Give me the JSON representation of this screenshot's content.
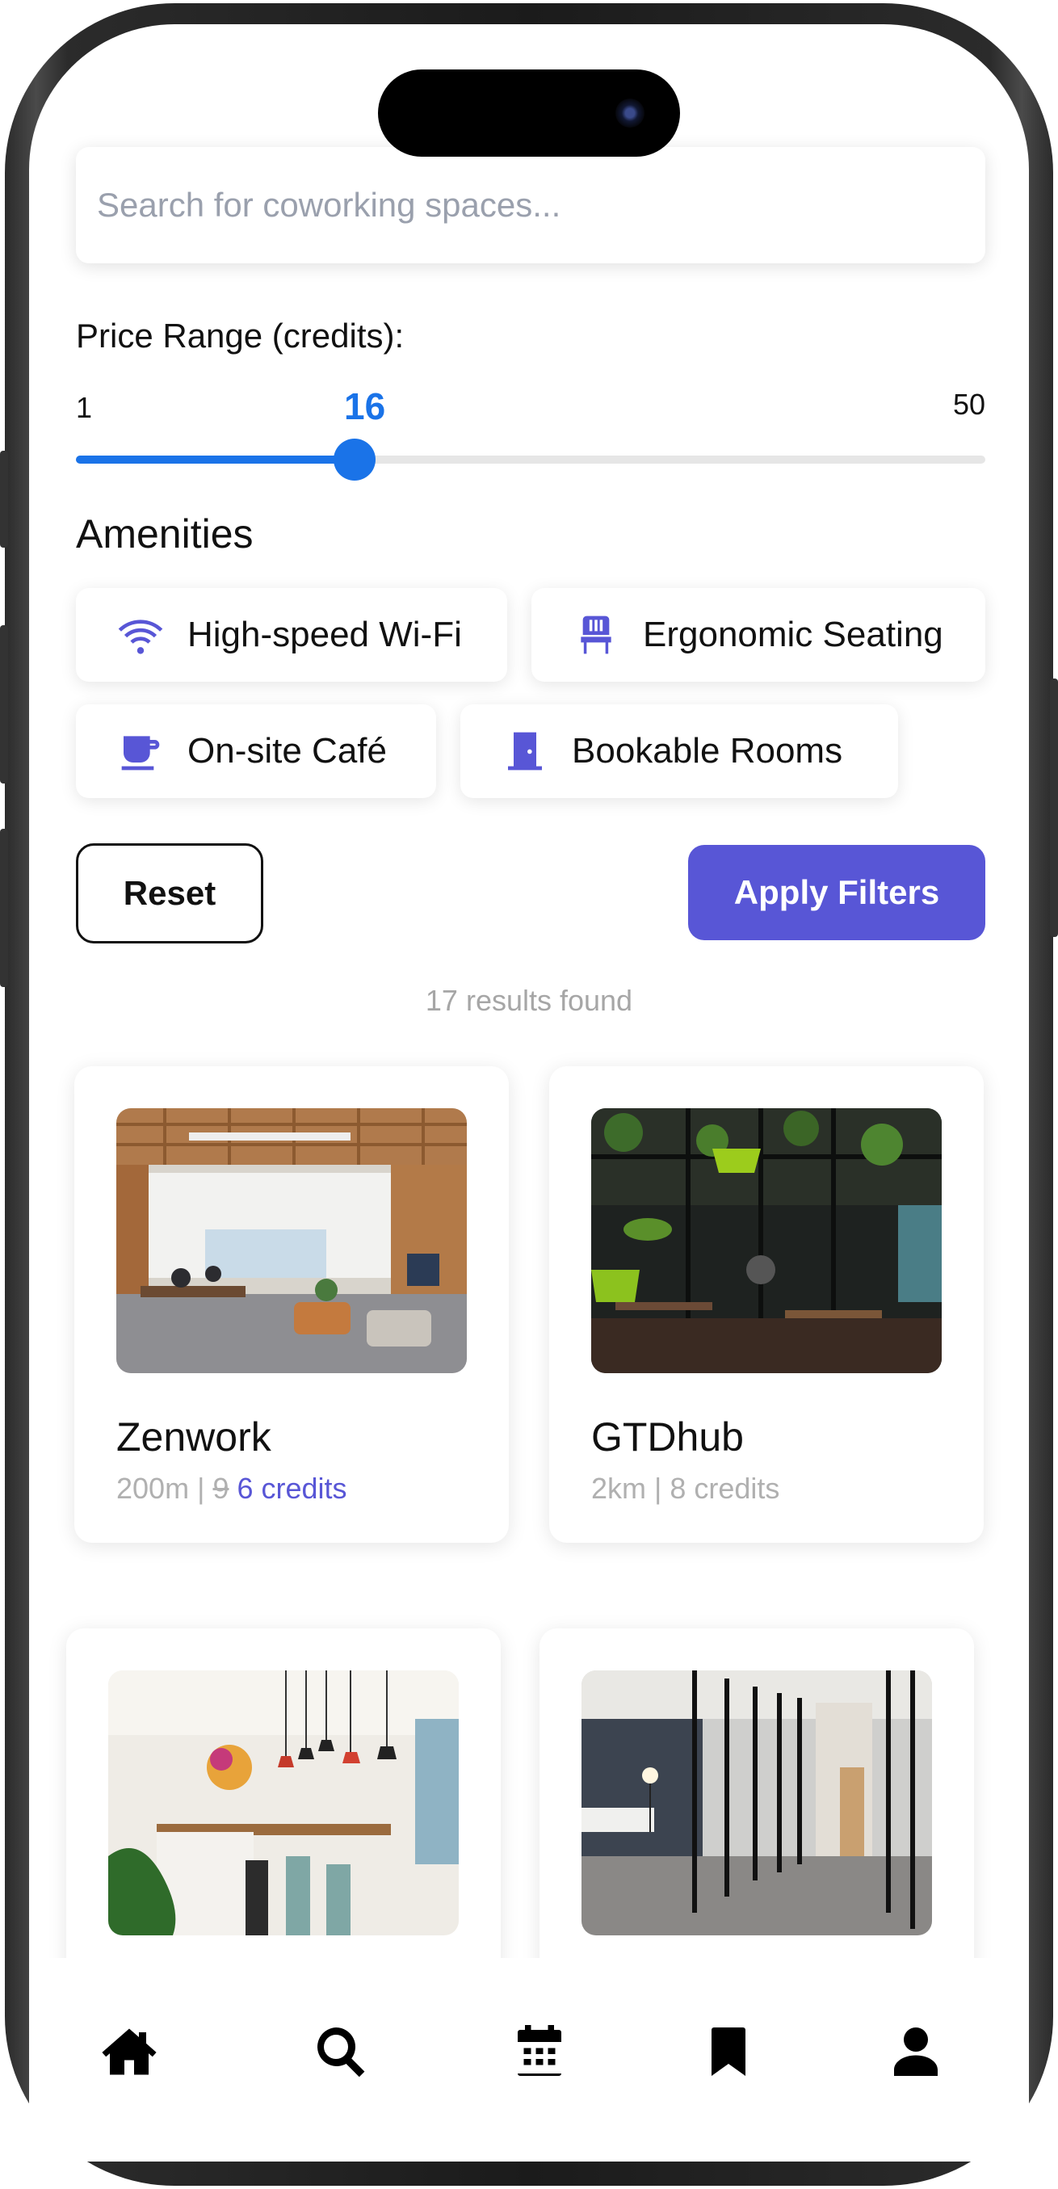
{
  "search": {
    "placeholder": "Search for coworking spaces..."
  },
  "filters": {
    "price_label": "Price Range (credits):",
    "price_min": "1",
    "price_max": "50",
    "price_value": "16",
    "price_fraction": 0.306,
    "amenities_title": "Amenities",
    "amenities": [
      {
        "label": "High-speed Wi-Fi",
        "icon": "wifi-icon"
      },
      {
        "label": "Ergonomic Seating",
        "icon": "chair-icon"
      },
      {
        "label": "On-site Café",
        "icon": "coffee-cup-icon"
      },
      {
        "label": "Bookable Rooms",
        "icon": "door-icon"
      }
    ],
    "reset_label": "Reset",
    "apply_label": "Apply Filters"
  },
  "results_text": "17 results found",
  "listings": [
    {
      "name": "Zenwork",
      "distance": "200m",
      "separator": "|",
      "old_price": "9",
      "credits": "6 credits",
      "image": "open-plan-office-photo"
    },
    {
      "name": "GTDhub",
      "distance_credits": "2km | 8 credits",
      "image": "plant-filled-lounge-photo"
    },
    {
      "name": "",
      "image": "cafe-counter-pendant-lamps-photo"
    },
    {
      "name": "",
      "image": "glass-walled-corridor-photo"
    }
  ],
  "nav": [
    "home-icon",
    "search-icon",
    "calendar-icon",
    "bookmark-icon",
    "user-icon"
  ],
  "colors": {
    "accent": "#5856d6",
    "slider": "#1a73e8",
    "muted": "#a6a6a6"
  }
}
